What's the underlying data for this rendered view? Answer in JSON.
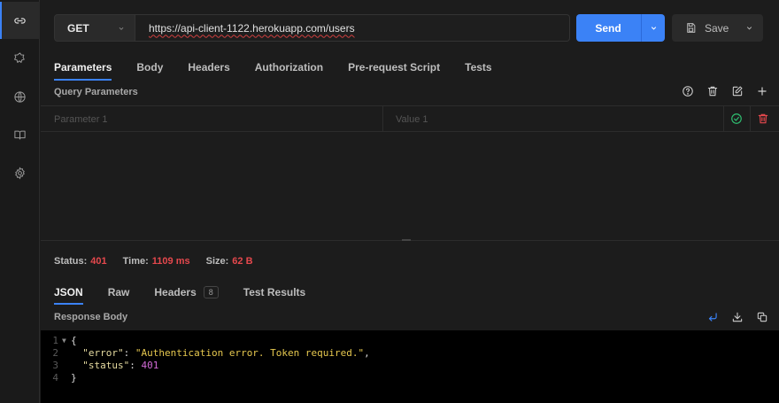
{
  "request": {
    "method": "GET",
    "url": "https://api-client-1122.herokuapp.com/users",
    "send_label": "Send",
    "save_label": "Save"
  },
  "request_tabs": [
    "Parameters",
    "Body",
    "Headers",
    "Authorization",
    "Pre-request Script",
    "Tests"
  ],
  "query_params": {
    "title": "Query Parameters",
    "key_placeholder": "Parameter 1",
    "value_placeholder": "Value 1"
  },
  "response": {
    "status_label": "Status:",
    "status_value": "401",
    "time_label": "Time:",
    "time_value": "1109 ms",
    "size_label": "Size:",
    "size_value": "62 B",
    "tabs": [
      {
        "label": "JSON"
      },
      {
        "label": "Raw"
      },
      {
        "label": "Headers",
        "badge": "8"
      },
      {
        "label": "Test Results"
      }
    ],
    "body_title": "Response Body",
    "line_numbers": [
      "1",
      "2",
      "3",
      "4"
    ],
    "code": {
      "open": "{",
      "key1": "\"error\"",
      "val1": "\"Authentication error. Token required.\"",
      "key2": "\"status\"",
      "val2": "401",
      "close": "}"
    }
  },
  "colors": {
    "accent": "#3b82f6",
    "error": "#e5484d",
    "success": "#2fbf71"
  },
  "icons": {
    "sidebar": [
      "link-icon",
      "collections-icon",
      "globe-icon",
      "book-icon",
      "settings-icon"
    ],
    "query_params": [
      "help-icon",
      "trash-icon",
      "edit-icon",
      "plus-icon"
    ],
    "response_body": [
      "wrap-icon",
      "download-icon",
      "copy-icon"
    ]
  }
}
